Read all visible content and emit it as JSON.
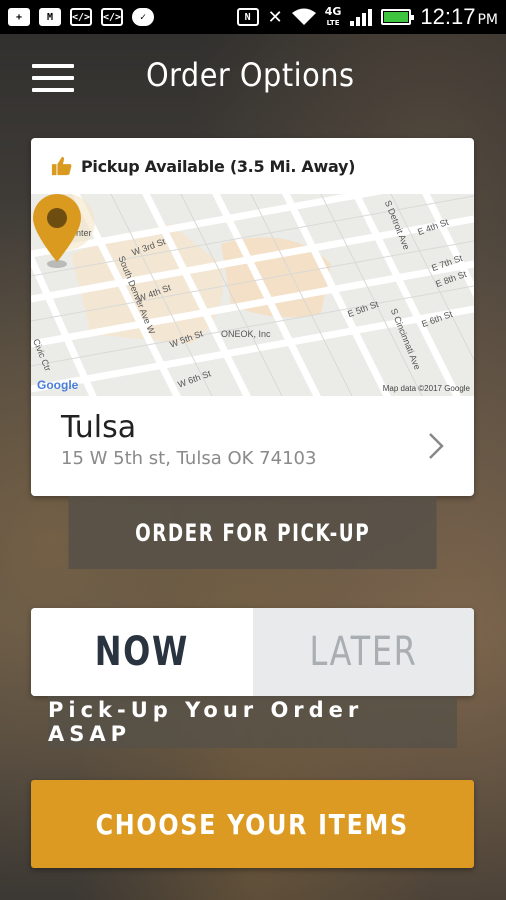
{
  "status_bar": {
    "time": "12:17",
    "ampm": "PM",
    "network": "4G",
    "network_sub": "LTE",
    "icons": [
      "plus-icon",
      "gmail-icon",
      "code-icon",
      "code-icon",
      "chat-icon",
      "nfc-icon",
      "mute-icon",
      "wifi-icon",
      "signal-icon",
      "battery-icon"
    ],
    "battery_level": 0.9
  },
  "header": {
    "title": "Order Options",
    "menu_icon": "hamburger-icon"
  },
  "location_card": {
    "availability": "Pickup Available (3.5 Mi. Away)",
    "availability_icon": "thumbs-up-icon",
    "name": "Tulsa",
    "address": "15 W 5th st, Tulsa OK 74103",
    "chevron_icon": "chevron-right-icon",
    "map": {
      "labels": {
        "bok": "BOK Center",
        "w3rd": "W 3rd St",
        "w4th": "W 4th St",
        "w5th": "W 5th St",
        "w6th": "W 6th St",
        "e5th": "E 5th St",
        "e6th": "E 6th St",
        "e7th": "E 7th St",
        "e8th": "E 8th St",
        "e4th": "E 4th St",
        "denver": "South Denver Ave W",
        "detroit": "S Detroit Ave",
        "cincinnati": "S Cincinnati Ave",
        "civic": "Civic Ctr",
        "oneok": "ONEOK, Inc",
        "google": "Google",
        "mapdata": "Map data ©2017 Google"
      },
      "pin_color": "#d99a1f"
    }
  },
  "pickup_button": {
    "label": "ORDER FOR PICK-UP"
  },
  "timing_toggle": {
    "options": [
      "NOW",
      "LATER"
    ],
    "selected": "NOW"
  },
  "timing_caption": "Pick-Up Your Order ASAP",
  "choose_button": {
    "label": "CHOOSE YOUR ITEMS",
    "color": "#dc9a22"
  }
}
